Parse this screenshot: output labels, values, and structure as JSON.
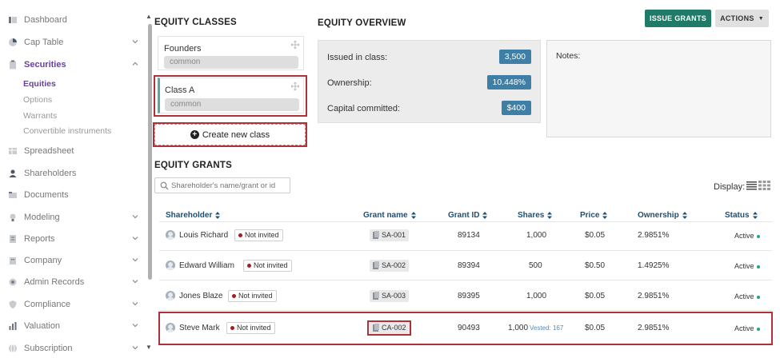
{
  "sidebar": {
    "items": [
      {
        "label": "Dashboard",
        "icon": "dashboard-icon"
      },
      {
        "label": "Cap Table",
        "icon": "pie-chart-icon"
      },
      {
        "label": "Securities",
        "icon": "clipboard-icon"
      },
      {
        "label": "Spreadsheet",
        "icon": "table-icon"
      },
      {
        "label": "Shareholders",
        "icon": "user-icon"
      },
      {
        "label": "Documents",
        "icon": "folder-icon"
      },
      {
        "label": "Modeling",
        "icon": "lightbulb-icon"
      },
      {
        "label": "Reports",
        "icon": "report-icon"
      },
      {
        "label": "Company",
        "icon": "building-icon"
      },
      {
        "label": "Admin Records",
        "icon": "admin-icon"
      },
      {
        "label": "Compliance",
        "icon": "shield-icon"
      },
      {
        "label": "Valuation",
        "icon": "bar-chart-icon"
      },
      {
        "label": "Subscription",
        "icon": "globe-icon"
      }
    ],
    "securities_sub": [
      "Equities",
      "Options",
      "Warrants",
      "Convertible instruments"
    ]
  },
  "equity_classes": {
    "title": "EQUITY CLASSES",
    "classes": [
      {
        "name": "Founders",
        "type": "common"
      },
      {
        "name": "Class A",
        "type": "common"
      }
    ],
    "create_label": "Create new class"
  },
  "overview": {
    "title": "EQUITY OVERVIEW",
    "issued_label": "Issued in class:",
    "issued_value": "3,500",
    "ownership_label": "Ownership:",
    "ownership_value": "10.448%",
    "capital_label": "Capital committed:",
    "capital_value": "$400",
    "notes_label": "Notes:"
  },
  "toolbar": {
    "issue_label": "ISSUE GRANTS",
    "actions_label": "ACTIONS"
  },
  "grants": {
    "title": "EQUITY GRANTS",
    "search_placeholder": "Shareholder's name/grant or id",
    "display_label": "Display:",
    "columns": [
      "Shareholder",
      "Grant name",
      "Grant ID",
      "Shares",
      "Price",
      "Ownership",
      "Status"
    ],
    "rows": [
      {
        "shareholder": "Louis Richard",
        "invite": "Not invited",
        "grant_name": "SA-001",
        "grant_id": "89134",
        "shares": "1,000",
        "vested": "",
        "price": "$0.05",
        "ownership": "2.9851%",
        "status": "Active"
      },
      {
        "shareholder": "Edward William",
        "invite": "Not invited",
        "grant_name": "SA-002",
        "grant_id": "89394",
        "shares": "500",
        "vested": "",
        "price": "$0.50",
        "ownership": "1.4925%",
        "status": "Active"
      },
      {
        "shareholder": "Jones Blaze",
        "invite": "Not invited",
        "grant_name": "SA-003",
        "grant_id": "89395",
        "shares": "1,000",
        "vested": "",
        "price": "$0.05",
        "ownership": "2.9851%",
        "status": "Active"
      },
      {
        "shareholder": "Steve Mark",
        "invite": "Not invited",
        "grant_name": "CA-002",
        "grant_id": "90493",
        "shares": "1,000",
        "vested": "Vested: 167",
        "price": "$0.05",
        "ownership": "2.9851%",
        "status": "Active"
      }
    ]
  },
  "colors": {
    "accent_purple": "#6a3fa0",
    "issue_green": "#1f7a68",
    "value_blue": "#3f7fa6",
    "highlight_red": "#b0313a",
    "header_blue": "#1d4f73",
    "status_green": "#2aa57a"
  }
}
